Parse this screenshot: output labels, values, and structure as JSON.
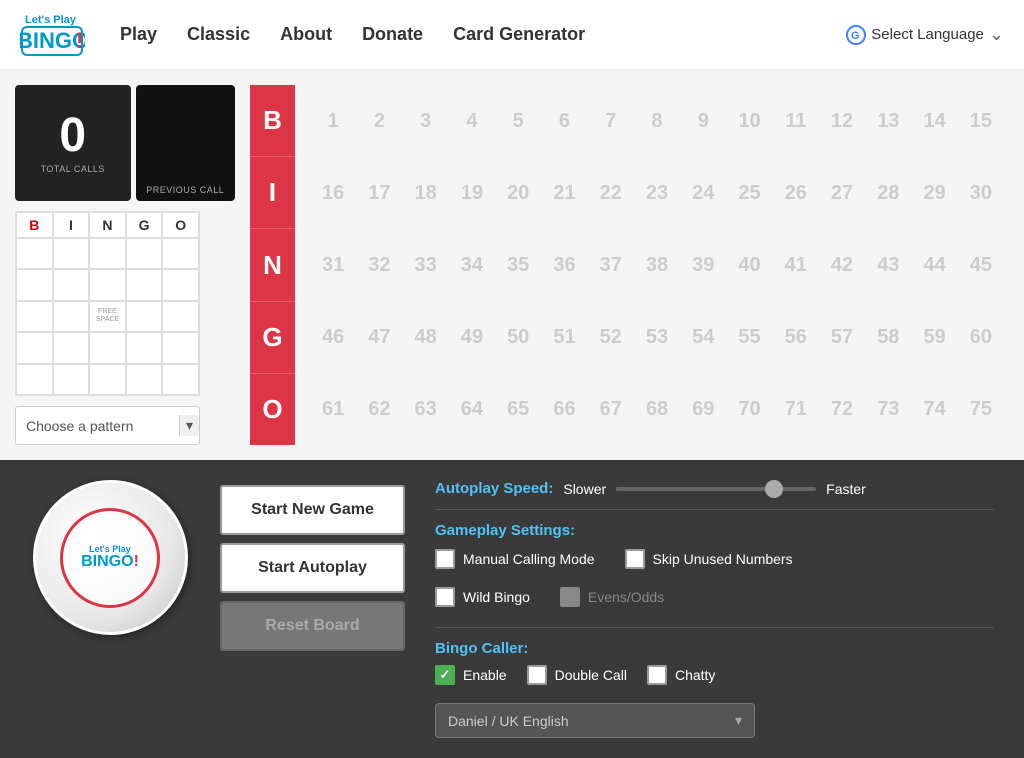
{
  "header": {
    "logo_line1": "Let's Play",
    "logo_line2": "BINGO!",
    "nav": [
      {
        "label": "Play",
        "id": "play"
      },
      {
        "label": "Classic",
        "id": "classic"
      },
      {
        "label": "About",
        "id": "about"
      },
      {
        "label": "Donate",
        "id": "donate"
      },
      {
        "label": "Card Generator",
        "id": "card-generator"
      }
    ],
    "lang_label": "Select Language"
  },
  "game": {
    "total_calls": "0",
    "total_calls_label": "TOTAL CALLS",
    "prev_call_label": "PREVIOUS CALL",
    "bingo_letters": [
      "B",
      "I",
      "N",
      "G",
      "O"
    ],
    "bingo_card_headers": [
      "B",
      "I",
      "N",
      "G",
      "O"
    ],
    "free_space_text": "FREE SPACE",
    "pattern_dropdown": "Choose a pattern"
  },
  "numbers": {
    "row1": [
      1,
      2,
      3,
      4,
      5,
      6,
      7,
      8,
      9,
      10,
      11,
      12,
      13,
      14,
      15
    ],
    "row2": [
      16,
      17,
      18,
      19,
      20,
      21,
      22,
      23,
      24,
      25,
      26,
      27,
      28,
      29,
      30
    ],
    "row3": [
      31,
      32,
      33,
      34,
      35,
      36,
      37,
      38,
      39,
      40,
      41,
      42,
      43,
      44,
      45
    ],
    "row4": [
      46,
      47,
      48,
      49,
      50,
      51,
      52,
      53,
      54,
      55,
      56,
      57,
      58,
      59,
      60
    ],
    "row5": [
      61,
      62,
      63,
      64,
      65,
      66,
      67,
      68,
      69,
      70,
      71,
      72,
      73,
      74,
      75
    ]
  },
  "bottom": {
    "ball_logo_line1": "Let's Play",
    "ball_bingo": "BINGO",
    "ball_exclaim": "!",
    "btn_start_new": "Start New Game",
    "btn_autoplay": "Start Autoplay",
    "btn_reset": "Reset Board",
    "autoplay_label": "Autoplay Speed:",
    "speed_slower": "Slower",
    "speed_faster": "Faster",
    "gameplay_label": "Gameplay Settings:",
    "settings": {
      "manual_calling": "Manual Calling Mode",
      "skip_unused": "Skip Unused Numbers",
      "wild_bingo": "Wild Bingo",
      "evens_odds": "Evens/Odds"
    },
    "bingo_caller_label": "Bingo Caller:",
    "caller_settings": {
      "enable": "Enable",
      "double_call": "Double Call",
      "chatty": "Chatty"
    },
    "caller_voice": "Daniel / UK English"
  }
}
